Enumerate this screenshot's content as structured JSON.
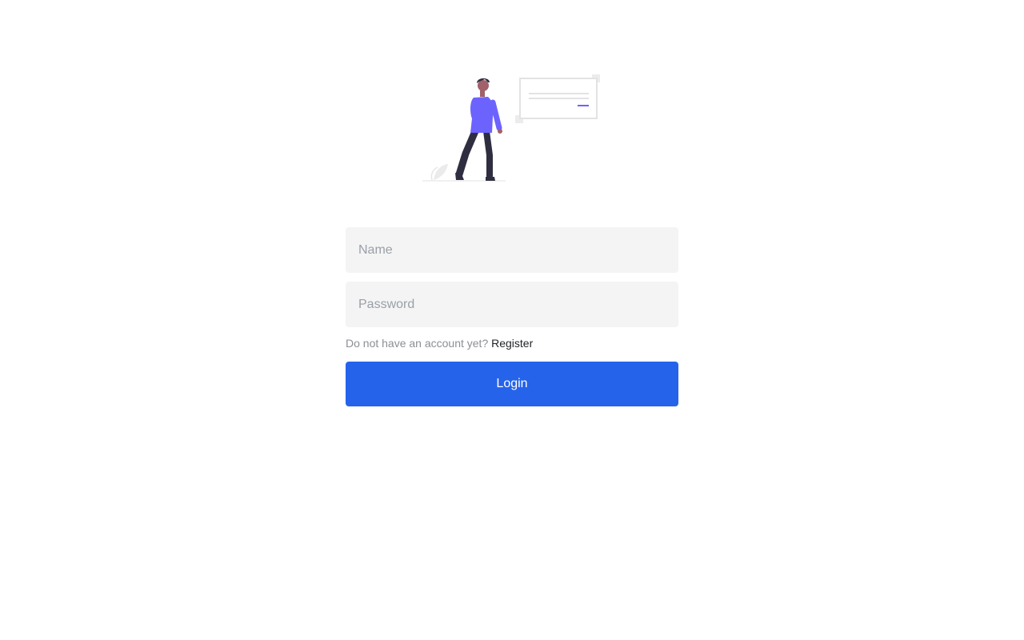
{
  "login_form": {
    "name_placeholder": "Name",
    "password_placeholder": "Password",
    "register_prompt": "Do not have an account yet?",
    "register_link_label": "Register",
    "login_button_label": "Login"
  },
  "illustration": {
    "icon": "person-with-message-card-illustration",
    "accent_color": "#6c63ff",
    "skin_color": "#a0616a",
    "dark_color": "#2f2e41"
  },
  "colors": {
    "button": "#2563eb",
    "field_background": "#f4f4f4",
    "muted_text": "#8c8f94"
  }
}
